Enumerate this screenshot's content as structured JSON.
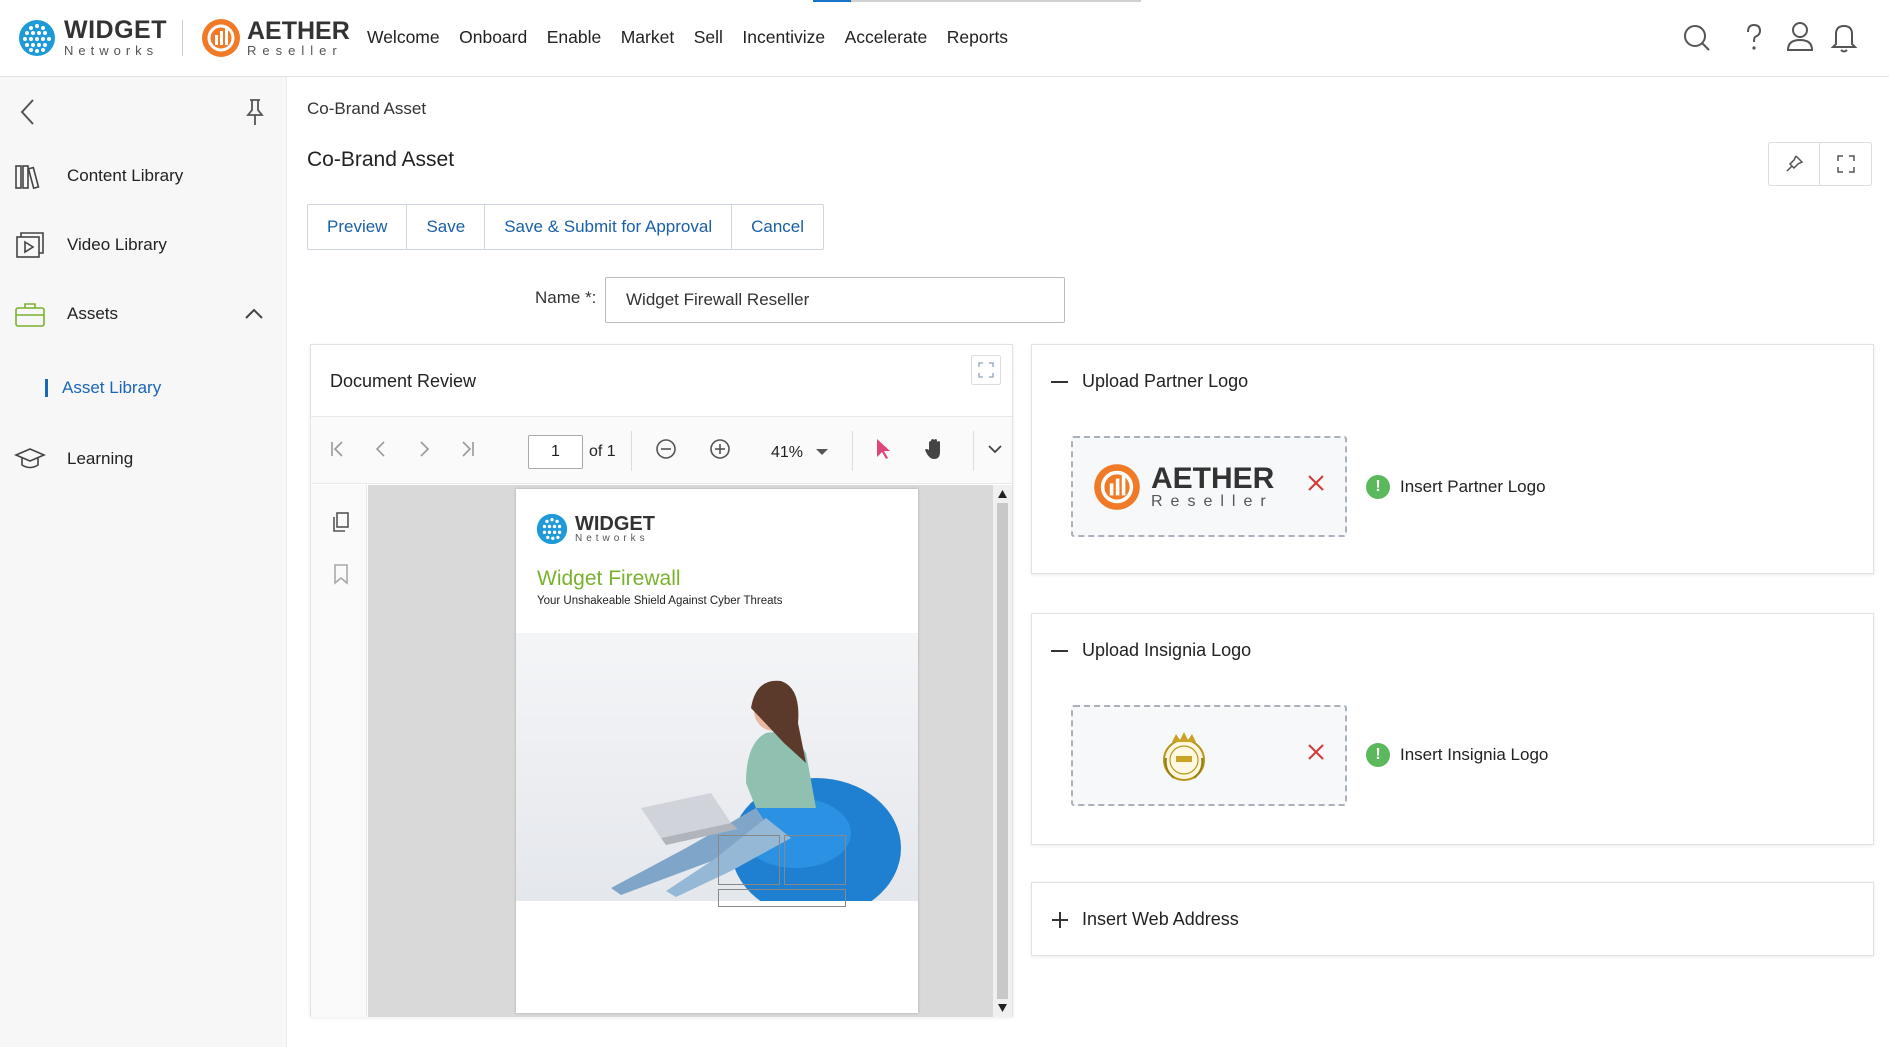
{
  "header": {
    "brand_primary": {
      "name": "WIDGET",
      "tagline": "Networks"
    },
    "brand_secondary": {
      "name": "AETHER",
      "tagline": "Reseller"
    },
    "nav": [
      "Welcome",
      "Onboard",
      "Enable",
      "Market",
      "Sell",
      "Incentivize",
      "Accelerate",
      "Reports"
    ],
    "icons": [
      "search-icon",
      "help-icon",
      "user-icon",
      "bell-icon"
    ]
  },
  "sidebar": {
    "items": [
      {
        "label": "Content Library",
        "icon": "books-icon"
      },
      {
        "label": "Video Library",
        "icon": "video-icon"
      },
      {
        "label": "Assets",
        "icon": "briefcase-icon"
      },
      {
        "label": "Learning",
        "icon": "graduation-cap-icon"
      }
    ],
    "sub_item": "Asset Library"
  },
  "page": {
    "breadcrumb": "Co-Brand Asset",
    "title": "Co-Brand Asset",
    "actions": [
      "Preview",
      "Save",
      "Save & Submit for Approval",
      "Cancel"
    ],
    "name_label": "Name *:",
    "name_value": "Widget Firewall Reseller"
  },
  "document_review": {
    "title": "Document Review",
    "page_number": "1",
    "page_of": "of 1",
    "zoom": "41%",
    "document": {
      "brand": "WIDGET",
      "brand_tagline": "Networks",
      "title": "Widget Firewall",
      "subtitle": "Your Unshakeable Shield Against Cyber Threats"
    }
  },
  "partner_logo": {
    "header": "Upload Partner Logo",
    "logo_name": "AETHER",
    "logo_tagline": "Reseller",
    "insert_label": "Insert Partner Logo"
  },
  "insignia_logo": {
    "header": "Upload Insignia Logo",
    "insert_label": "Insert Insignia Logo"
  },
  "web_address": {
    "header": "Insert Web Address"
  },
  "colors": {
    "accent_blue": "#1a5fa8",
    "brand_orange": "#f07a26",
    "brand_green": "#7ab22e",
    "success_green": "#5cb85c",
    "remove_red": "#d43a3a"
  }
}
